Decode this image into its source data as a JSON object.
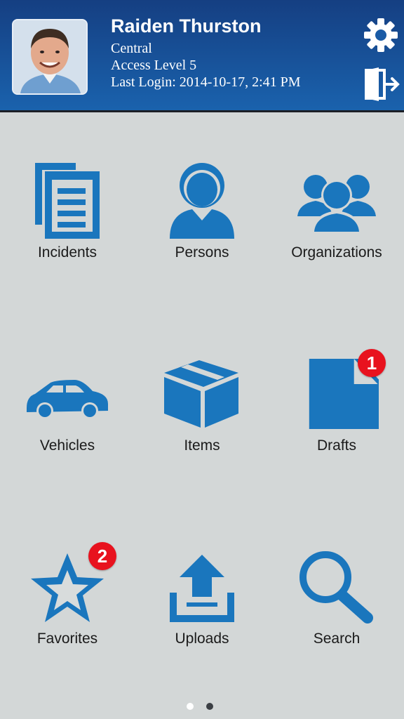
{
  "user": {
    "name": "Raiden Thurston",
    "region": "Central",
    "access": "Access Level 5",
    "last_login": "Last Login: 2014-10-17, 2:41 PM"
  },
  "icons": {
    "settings": "gear-icon",
    "logout": "logout-door-icon"
  },
  "colors": {
    "header_start": "#153f82",
    "header_end": "#1a62ad",
    "icon_blue": "#1a76bd",
    "badge_red": "#e8121e",
    "background": "#d3d7d7"
  },
  "menu": [
    {
      "label": "Incidents",
      "icon": "incidents-icon"
    },
    {
      "label": "Persons",
      "icon": "person-icon"
    },
    {
      "label": "Organizations",
      "icon": "organizations-icon"
    },
    {
      "label": "Vehicles",
      "icon": "car-icon"
    },
    {
      "label": "Items",
      "icon": "box-icon"
    },
    {
      "label": "Drafts",
      "icon": "document-icon",
      "badge": "1"
    },
    {
      "label": "Favorites",
      "icon": "star-icon",
      "badge": "2"
    },
    {
      "label": "Uploads",
      "icon": "upload-icon"
    },
    {
      "label": "Search",
      "icon": "search-icon"
    }
  ],
  "pager": {
    "pages": 2,
    "current": 1
  }
}
